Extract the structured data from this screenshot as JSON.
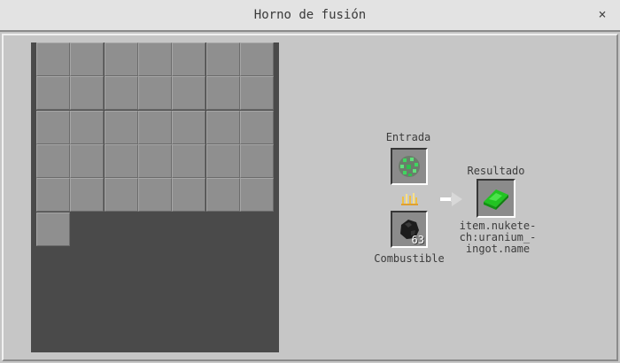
{
  "window": {
    "title": "Horno de fusión",
    "close_symbol": "×"
  },
  "inventory": {
    "rows": 6,
    "columns": 7,
    "filled_slots": 36
  },
  "furnace": {
    "input_label": "Entrada",
    "fuel_label": "Combustible",
    "result_label": "Resultado",
    "input_item_icon": "uranium-ore-icon",
    "fuel_item_icon": "coal-icon",
    "fuel_count": "63",
    "burn_icon": "fire-icon",
    "progress_arrow_icon": "arrow-right-icon",
    "result_item_icon": "uranium-ingot-icon",
    "result_item_name": "item.nukete-ch:uranium_-ingot.name",
    "result_name_lines": [
      "item.nukete-",
      "ch:uranium_-",
      "ingot.name"
    ]
  },
  "colors": {
    "ingot_green": "#22c322",
    "ore_green": "#3fd65f",
    "panel_bg": "#c6c6c6",
    "inventory_bg": "#4a4a4a"
  }
}
